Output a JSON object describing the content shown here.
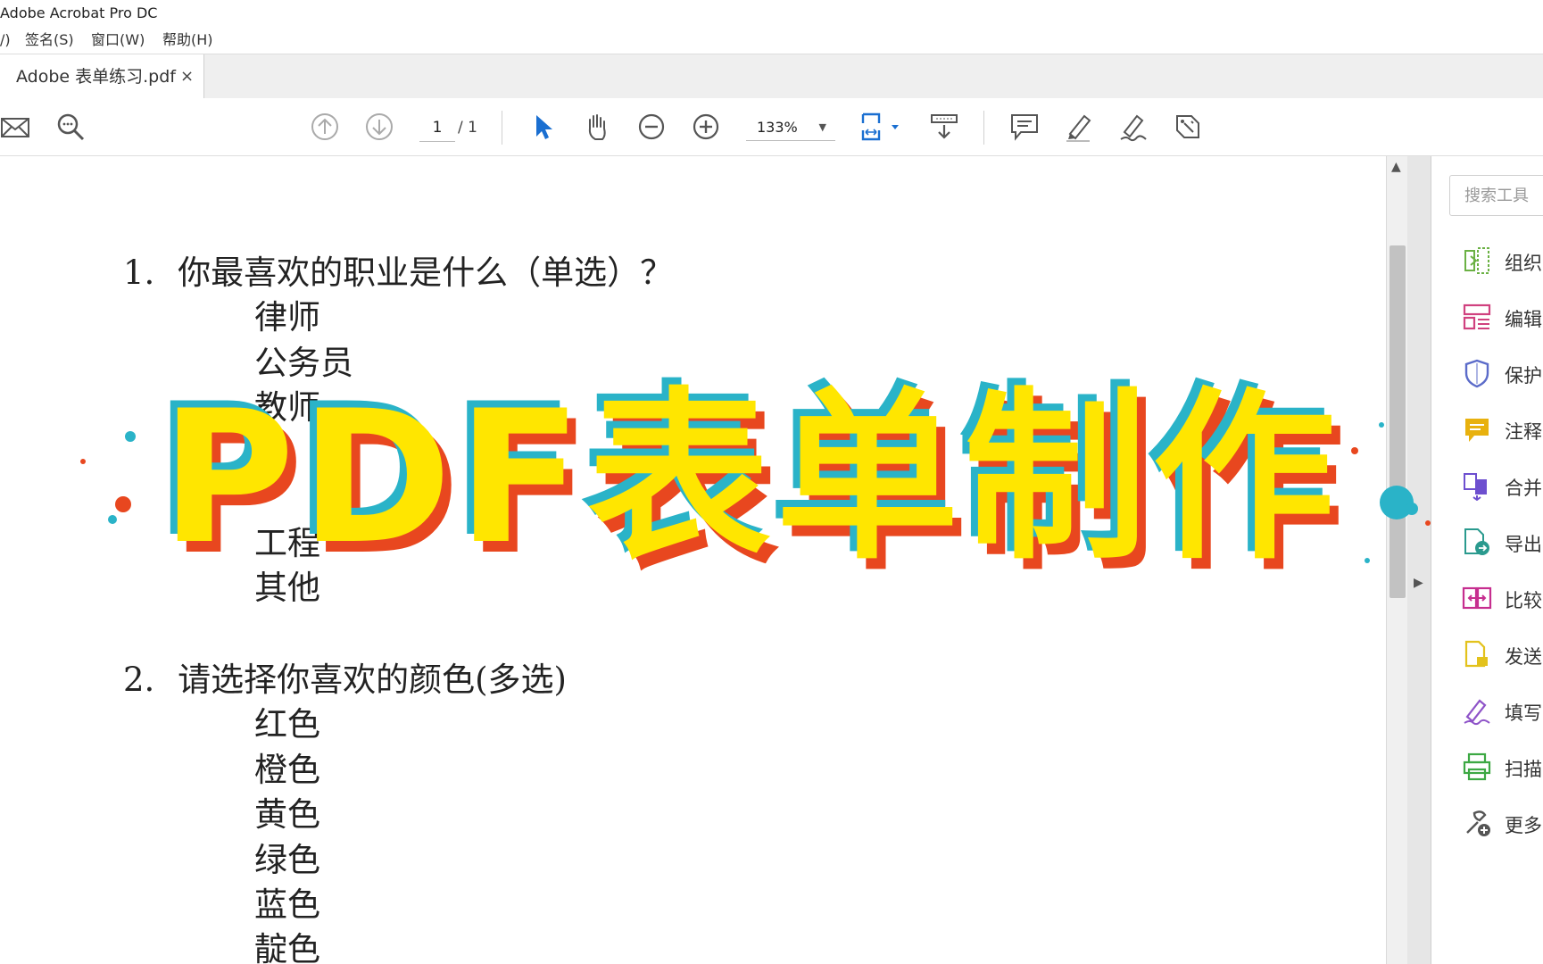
{
  "window": {
    "title": "Adobe Acrobat Pro DC"
  },
  "menu": {
    "items": [
      "/)",
      "签名(S)",
      "窗口(W)",
      "帮助(H)"
    ]
  },
  "tab": {
    "label": "Adobe 表单练习.pdf",
    "close": "×"
  },
  "toolbar": {
    "page_current": "1",
    "page_total": "/ 1",
    "zoom": "133%",
    "zoom_caret": "▼",
    "icons": [
      "mail-icon",
      "search-icon",
      "page-up-icon",
      "page-down-icon",
      "select-icon",
      "hand-icon",
      "zoom-out-icon",
      "zoom-in-icon",
      "fit-page-icon",
      "scroll-mode-icon",
      "comment-icon",
      "highlight-icon",
      "sign-icon",
      "stamp-icon"
    ]
  },
  "document": {
    "q1": {
      "number": "1.",
      "text": "你最喜欢的职业是什么（单选）？",
      "options": [
        "律师",
        "公务员",
        "教师",
        "",
        "",
        "工程",
        "其他"
      ]
    },
    "q2": {
      "number": "2.",
      "text": "请选择你喜欢的颜色(多选)",
      "options": [
        "红色",
        "橙色",
        "黄色",
        "绿色",
        "蓝色",
        "靛色"
      ]
    }
  },
  "overlay_title": "PDF表单制作",
  "right_panel": {
    "search_placeholder": "搜索工具",
    "tools": [
      {
        "label": "组织",
        "icon": "organize-pages-icon",
        "color": "#6bb144"
      },
      {
        "label": "编辑",
        "icon": "edit-pdf-icon",
        "color": "#d0417f"
      },
      {
        "label": "保护",
        "icon": "protect-shield-icon",
        "color": "#5b6bc9"
      },
      {
        "label": "注释",
        "icon": "comment-tool-icon",
        "color": "#e8b10e"
      },
      {
        "label": "合并",
        "icon": "combine-files-icon",
        "color": "#6d4fcf"
      },
      {
        "label": "导出",
        "icon": "export-pdf-icon",
        "color": "#2a9a8e"
      },
      {
        "label": "比较",
        "icon": "compare-icon",
        "color": "#c62e8f"
      },
      {
        "label": "发送",
        "icon": "send-icon",
        "color": "#e3c21c"
      },
      {
        "label": "填写",
        "icon": "fill-sign-icon",
        "color": "#8e53c8"
      },
      {
        "label": "扫描",
        "icon": "scan-icon",
        "color": "#3ca843"
      },
      {
        "label": "更多",
        "icon": "more-tools-icon",
        "color": "#555555"
      }
    ]
  },
  "colors": {
    "title_fill": "#ffe600",
    "title_shadow_red": "#e8471f",
    "title_shadow_cyan": "#2ab3c8",
    "accent_blue": "#1a6fd1"
  }
}
